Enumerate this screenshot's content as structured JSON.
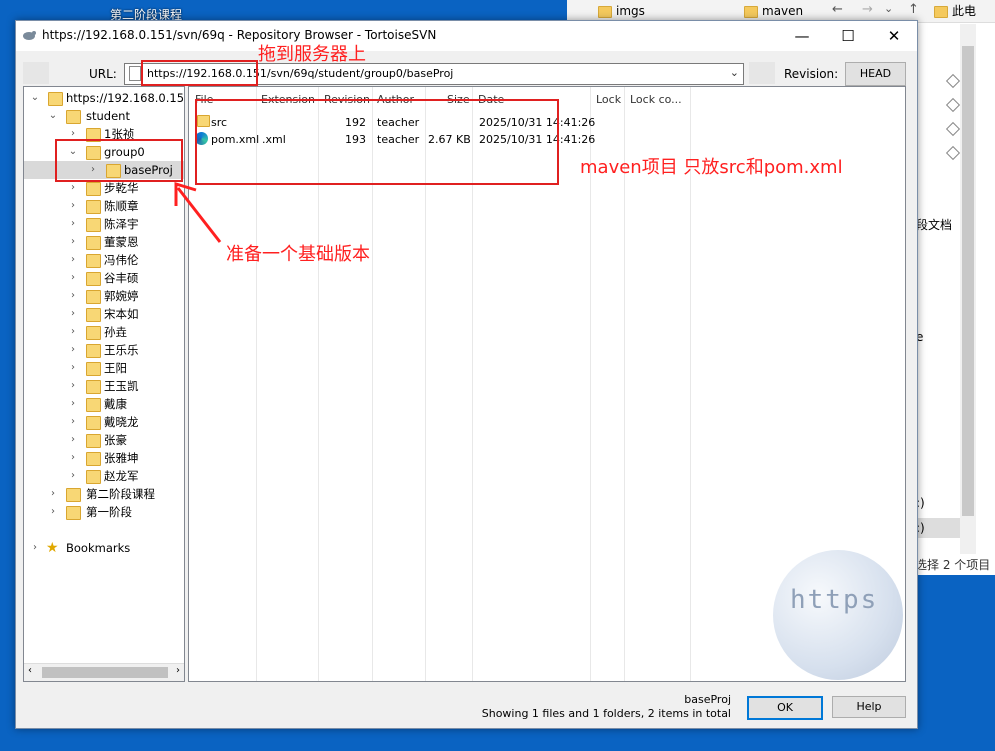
{
  "desktop": {
    "label": "第二阶段课程"
  },
  "background_explorer": {
    "tabs": [
      "imgs",
      "maven",
      "此电"
    ],
    "side_text_1": "段文档",
    "side_text_2": "e",
    "side_text_3": ":)",
    "side_text_4": ":)",
    "status": "选择 2 个项目"
  },
  "window": {
    "title": "https://192.168.0.151/svn/69q - Repository Browser - TortoiseSVN",
    "minimize": "—",
    "maximize": "☐",
    "close": "✕"
  },
  "toolbar": {
    "url_label": "URL:",
    "url_value": "https://192.168.0.151/svn/69q/student/group0/baseProj",
    "revision_label": "Revision:",
    "revision_button": "HEAD"
  },
  "tree": {
    "root": "https://192.168.0.151/s",
    "student": "student",
    "children": [
      "1张祯",
      "group0",
      "baseProj",
      "步乾华",
      "陈顺章",
      "陈泽宇",
      "董蒙恩",
      "冯伟伦",
      "谷丰硕",
      "郭婉婷",
      "宋本如",
      "孙垚",
      "王乐乐",
      "王阳",
      "王玉凯",
      "戴康",
      "戴晓龙",
      "张豪",
      "张雅坤",
      "赵龙军"
    ],
    "second_stage": "第二阶段课程",
    "first_stage": "第一阶段",
    "bookmarks": "Bookmarks"
  },
  "list": {
    "columns": [
      "File",
      "Extension",
      "Revision",
      "Author",
      "Size",
      "Date",
      "Lock",
      "Lock co..."
    ],
    "rows": [
      {
        "file": "src",
        "ext": "",
        "revision": "192",
        "author": "teacher",
        "size": "",
        "date": "2025/10/31 14:41:26"
      },
      {
        "file": "pom.xml",
        "ext": ".xml",
        "revision": "193",
        "author": "teacher",
        "size": "2.67 KB",
        "date": "2025/10/31 14:41:26"
      }
    ]
  },
  "status": {
    "current": "baseProj",
    "summary": "Showing 1 files and 1 folders, 2 items in total",
    "ok": "OK",
    "help": "Help"
  },
  "annotations": {
    "drag_to_server": "拖到服务器上",
    "maven_note": "maven项目 只放src和pom.xml",
    "base_version": "准备一个基础版本"
  },
  "watermark": "https",
  "colors": {
    "annotation": "#ff2020",
    "accent": "#0078d7"
  }
}
